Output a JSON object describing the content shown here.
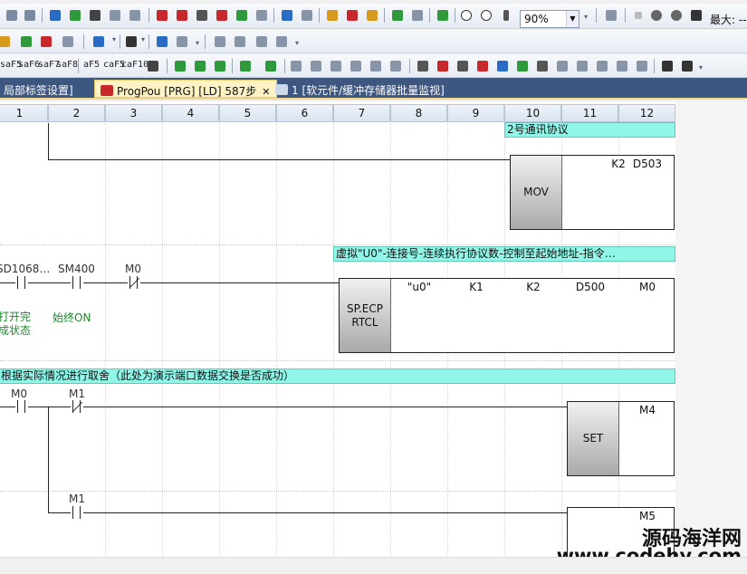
{
  "toolbar": {
    "zoom_value": "90%",
    "max_label": "最大: --",
    "func_keys": [
      "saF5",
      "saF6",
      "saF7",
      "saF8",
      "aF5",
      "caF5",
      "caF10"
    ],
    "colors": {
      "accent": "#2a6bc5",
      "icon_green": "#2f9a3c",
      "icon_red": "#c8282b"
    }
  },
  "tabs": [
    {
      "label": "局部标签设置]",
      "active": false
    },
    {
      "label": "ProgPou [PRG] [LD] 587步",
      "active": true
    },
    {
      "label": "1 [软元件/缓冲存储器批量监视]",
      "active": false
    }
  ],
  "columns": [
    "1",
    "2",
    "3",
    "4",
    "5",
    "6",
    "7",
    "8",
    "9",
    "10",
    "11",
    "12"
  ],
  "rungs": {
    "r1": {
      "comment": "2号通讯协议",
      "instruction": "MOV",
      "operands": [
        "K2",
        "D503"
      ]
    },
    "r2": {
      "comment": "虚拟\"U0\"-连接号-连续执行协议数-控制至起始地址-指令…",
      "contacts": [
        {
          "device": "SD1068…",
          "comment_line1": "打开完",
          "comment_line2": "成状态"
        },
        {
          "device": "SM400",
          "comment_line1": "始终ON"
        },
        {
          "device": "M0"
        }
      ],
      "instruction_line1": "SP.ECP",
      "instruction_line2": "RTCL",
      "operands": [
        "\"u0\"",
        "K1",
        "K2",
        "D500",
        "M0"
      ]
    },
    "r3": {
      "comment": "根据实际情况进行取舍（此处为演示端口数据交换是否成功）",
      "contacts": [
        {
          "device": "M0"
        },
        {
          "device": "M1"
        }
      ],
      "instruction": "SET",
      "operand": "M4"
    },
    "r4": {
      "contacts": [
        {
          "device": "M1"
        }
      ],
      "operand": "M5"
    }
  },
  "watermark": {
    "line1": "源码海洋网",
    "line2": "www.codehy.com"
  }
}
